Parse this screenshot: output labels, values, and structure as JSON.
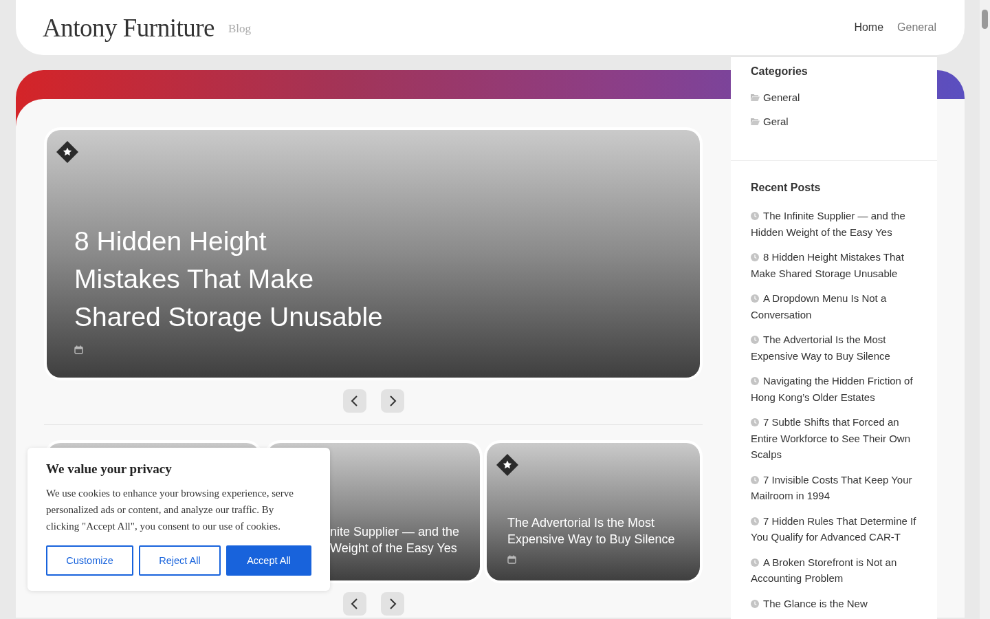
{
  "header": {
    "site_title": "Antony Furniture",
    "tagline": "Blog",
    "nav": [
      {
        "label": "Home",
        "selected": true
      },
      {
        "label": "General",
        "selected": false
      }
    ]
  },
  "featured": {
    "title_lines": [
      "8 Hidden Height",
      "Mistakes That Make",
      "Shared Storage Unusable"
    ],
    "badge": true,
    "date_icon": true
  },
  "post_cards": [
    {
      "kind": "plain"
    },
    {
      "title_lines": [
        "nite Supplier — and the",
        "Weight of the Easy Yes"
      ],
      "badge": false,
      "date_icon": false,
      "covered_left": true
    },
    {
      "title_lines": [
        "The Advertorial Is the Most",
        "Expensive Way to Buy Silence"
      ],
      "badge": true,
      "date_icon": true,
      "covered_left": false
    }
  ],
  "sidebar": {
    "categories": {
      "title": "Categories",
      "items": [
        "General",
        "Geral"
      ]
    },
    "recent_posts": {
      "title": "Recent Posts",
      "items": [
        "The Infinite Supplier — and the Hidden Weight of the Easy Yes",
        "8 Hidden Height Mistakes That Make Shared Storage Unusable",
        "A Dropdown Menu Is Not a Conversation",
        "The Advertorial Is the Most Expensive Way to Buy Silence",
        "Navigating the Hidden Friction of Hong Kong’s Older Estates",
        "7 Subtle Shifts that Forced an Entire Workforce to See Their Own Scalps",
        "7 Invisible Costs That Keep Your Mailroom in 1994",
        "7 Hidden Rules That Determine If You Qualify for Advanced CAR-T",
        "A Broken Storefront is Not an Accounting Problem",
        "The Glance is the New"
      ]
    }
  },
  "cookie_banner": {
    "title": "We value your privacy",
    "text": "We use cookies to enhance your browsing experience, serve personalized ads or content, and analyze our traffic. By clicking \"Accept All\", you consent to our use of cookies.",
    "buttons": [
      {
        "label": "Customize",
        "kind": "outline"
      },
      {
        "label": "Reject All",
        "kind": "outline"
      },
      {
        "label": "Accept All",
        "kind": "primary"
      }
    ]
  }
}
